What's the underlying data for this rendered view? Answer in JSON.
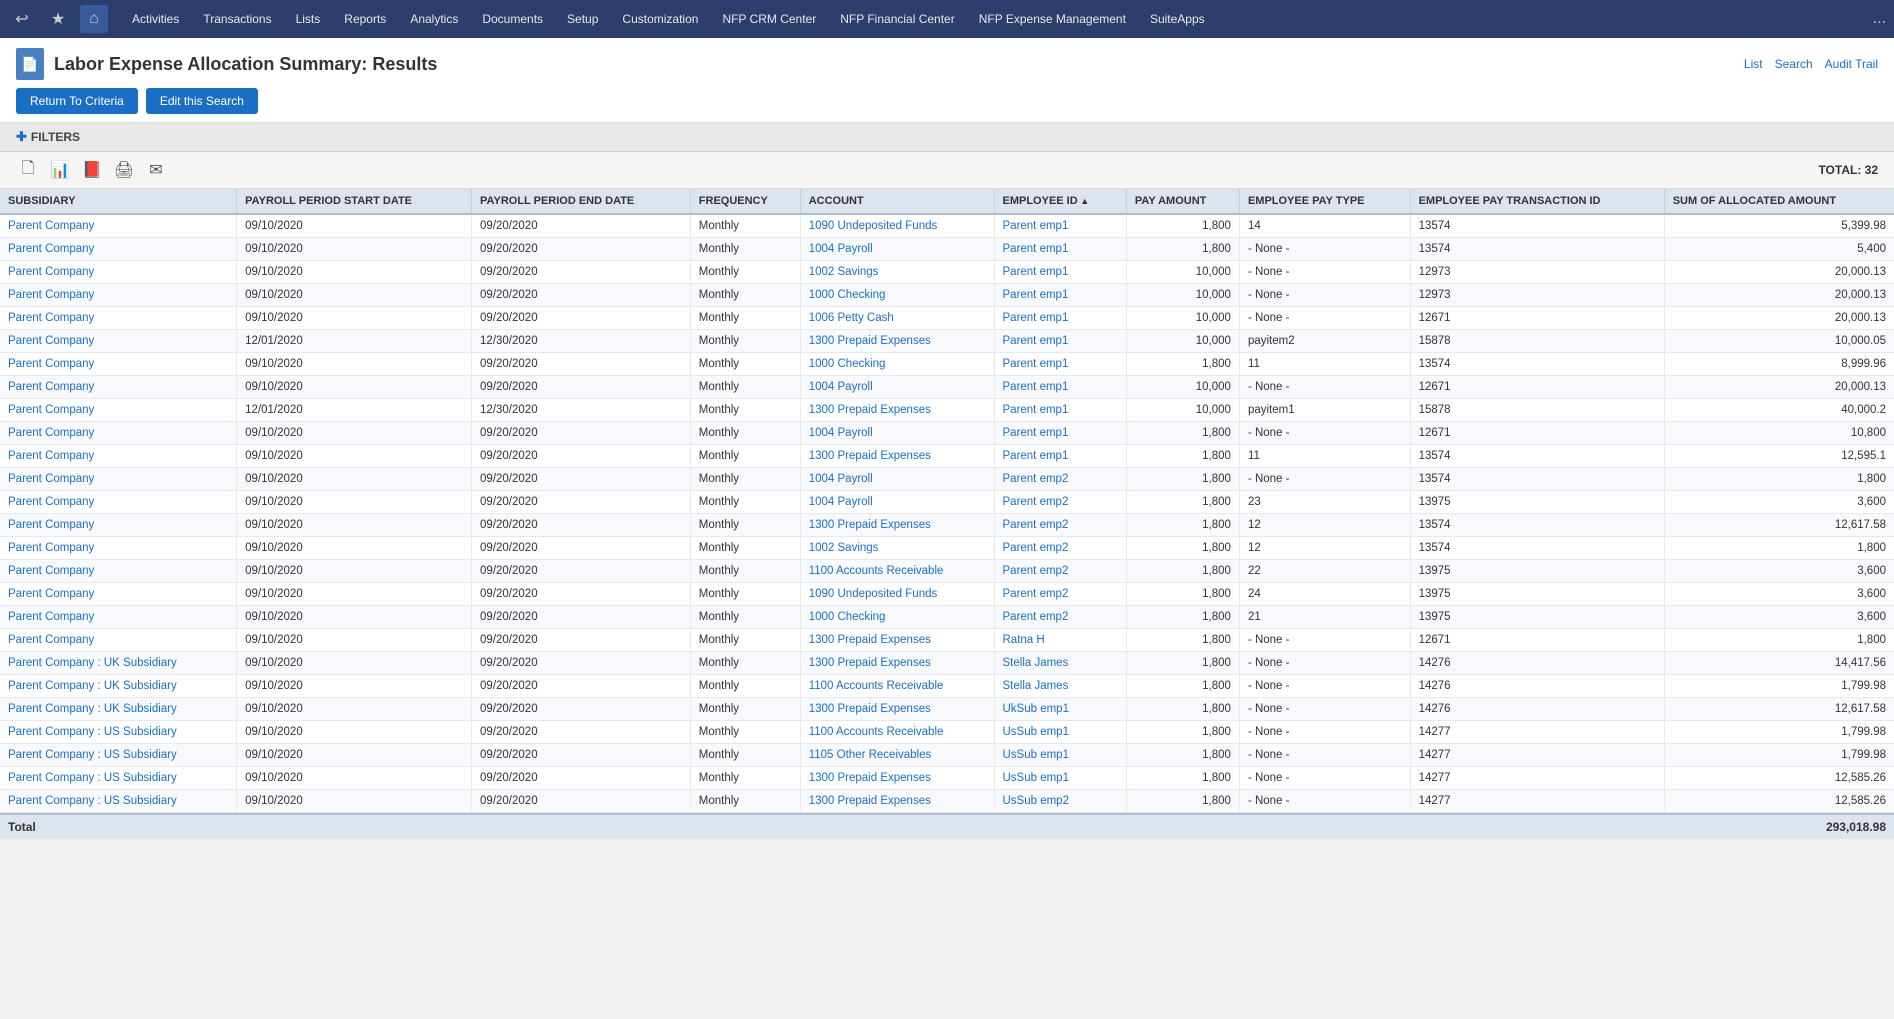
{
  "nav": {
    "items": [
      {
        "label": "Activities"
      },
      {
        "label": "Transactions"
      },
      {
        "label": "Lists"
      },
      {
        "label": "Reports"
      },
      {
        "label": "Analytics"
      },
      {
        "label": "Documents"
      },
      {
        "label": "Setup"
      },
      {
        "label": "Customization"
      },
      {
        "label": "NFP CRM Center"
      },
      {
        "label": "NFP Financial Center"
      },
      {
        "label": "NFP Expense Management"
      },
      {
        "label": "SuiteApps"
      }
    ],
    "more": "..."
  },
  "page": {
    "title": "Labor Expense Allocation Summary: Results",
    "icon": "📄",
    "actions": [
      "List",
      "Search",
      "Audit Trail"
    ],
    "buttons": [
      {
        "label": "Return To Criteria",
        "key": "return-criteria"
      },
      {
        "label": "Edit this Search",
        "key": "edit-search"
      }
    ],
    "filters_label": "FILTERS",
    "total_label": "TOTAL: 32"
  },
  "toolbar": {
    "icons": [
      {
        "name": "new-icon",
        "symbol": "🗋"
      },
      {
        "name": "excel-icon",
        "symbol": "📊"
      },
      {
        "name": "pdf-icon",
        "symbol": "📕"
      },
      {
        "name": "print-icon",
        "symbol": "🖨"
      },
      {
        "name": "email-icon",
        "symbol": "✉"
      }
    ]
  },
  "table": {
    "columns": [
      {
        "key": "subsidiary",
        "label": "SUBSIDIARY",
        "sort": "none"
      },
      {
        "key": "start_date",
        "label": "PAYROLL PERIOD START DATE",
        "sort": "none"
      },
      {
        "key": "end_date",
        "label": "PAYROLL PERIOD END DATE",
        "sort": "none"
      },
      {
        "key": "frequency",
        "label": "FREQUENCY",
        "sort": "none"
      },
      {
        "key": "account",
        "label": "ACCOUNT",
        "sort": "none"
      },
      {
        "key": "employee_id",
        "label": "EMPLOYEE ID",
        "sort": "asc"
      },
      {
        "key": "pay_amount",
        "label": "PAY AMOUNT",
        "sort": "none"
      },
      {
        "key": "pay_type",
        "label": "EMPLOYEE PAY TYPE",
        "sort": "none"
      },
      {
        "key": "transaction_id",
        "label": "EMPLOYEE PAY TRANSACTION ID",
        "sort": "none"
      },
      {
        "key": "allocated_amount",
        "label": "SUM OF ALLOCATED AMOUNT",
        "sort": "none"
      }
    ],
    "rows": [
      {
        "subsidiary": "Parent Company",
        "start_date": "09/10/2020",
        "end_date": "09/20/2020",
        "frequency": "Monthly",
        "account": "1090 Undeposited Funds",
        "employee_id": "Parent emp1",
        "pay_amount": "1,800",
        "pay_type": "14",
        "transaction_id": "13574",
        "allocated_amount": "5,399.98"
      },
      {
        "subsidiary": "Parent Company",
        "start_date": "09/10/2020",
        "end_date": "09/20/2020",
        "frequency": "Monthly",
        "account": "1004 Payroll",
        "employee_id": "Parent emp1",
        "pay_amount": "1,800",
        "pay_type": "- None -",
        "transaction_id": "13574",
        "allocated_amount": "5,400"
      },
      {
        "subsidiary": "Parent Company",
        "start_date": "09/10/2020",
        "end_date": "09/20/2020",
        "frequency": "Monthly",
        "account": "1002 Savings",
        "employee_id": "Parent emp1",
        "pay_amount": "10,000",
        "pay_type": "- None -",
        "transaction_id": "12973",
        "allocated_amount": "20,000.13"
      },
      {
        "subsidiary": "Parent Company",
        "start_date": "09/10/2020",
        "end_date": "09/20/2020",
        "frequency": "Monthly",
        "account": "1000 Checking",
        "employee_id": "Parent emp1",
        "pay_amount": "10,000",
        "pay_type": "- None -",
        "transaction_id": "12973",
        "allocated_amount": "20,000.13"
      },
      {
        "subsidiary": "Parent Company",
        "start_date": "09/10/2020",
        "end_date": "09/20/2020",
        "frequency": "Monthly",
        "account": "1006 Petty Cash",
        "employee_id": "Parent emp1",
        "pay_amount": "10,000",
        "pay_type": "- None -",
        "transaction_id": "12671",
        "allocated_amount": "20,000.13"
      },
      {
        "subsidiary": "Parent Company",
        "start_date": "12/01/2020",
        "end_date": "12/30/2020",
        "frequency": "Monthly",
        "account": "1300 Prepaid Expenses",
        "employee_id": "Parent emp1",
        "pay_amount": "10,000",
        "pay_type": "payitem2",
        "transaction_id": "15878",
        "allocated_amount": "10,000.05"
      },
      {
        "subsidiary": "Parent Company",
        "start_date": "09/10/2020",
        "end_date": "09/20/2020",
        "frequency": "Monthly",
        "account": "1000 Checking",
        "employee_id": "Parent emp1",
        "pay_amount": "1,800",
        "pay_type": "11",
        "transaction_id": "13574",
        "allocated_amount": "8,999.96"
      },
      {
        "subsidiary": "Parent Company",
        "start_date": "09/10/2020",
        "end_date": "09/20/2020",
        "frequency": "Monthly",
        "account": "1004 Payroll",
        "employee_id": "Parent emp1",
        "pay_amount": "10,000",
        "pay_type": "- None -",
        "transaction_id": "12671",
        "allocated_amount": "20,000.13"
      },
      {
        "subsidiary": "Parent Company",
        "start_date": "12/01/2020",
        "end_date": "12/30/2020",
        "frequency": "Monthly",
        "account": "1300 Prepaid Expenses",
        "employee_id": "Parent emp1",
        "pay_amount": "10,000",
        "pay_type": "payitem1",
        "transaction_id": "15878",
        "allocated_amount": "40,000.2"
      },
      {
        "subsidiary": "Parent Company",
        "start_date": "09/10/2020",
        "end_date": "09/20/2020",
        "frequency": "Monthly",
        "account": "1004 Payroll",
        "employee_id": "Parent emp1",
        "pay_amount": "1,800",
        "pay_type": "- None -",
        "transaction_id": "12671",
        "allocated_amount": "10,800"
      },
      {
        "subsidiary": "Parent Company",
        "start_date": "09/10/2020",
        "end_date": "09/20/2020",
        "frequency": "Monthly",
        "account": "1300 Prepaid Expenses",
        "employee_id": "Parent emp1",
        "pay_amount": "1,800",
        "pay_type": "11",
        "transaction_id": "13574",
        "allocated_amount": "12,595.1"
      },
      {
        "subsidiary": "Parent Company",
        "start_date": "09/10/2020",
        "end_date": "09/20/2020",
        "frequency": "Monthly",
        "account": "1004 Payroll",
        "employee_id": "Parent emp2",
        "pay_amount": "1,800",
        "pay_type": "- None -",
        "transaction_id": "13574",
        "allocated_amount": "1,800"
      },
      {
        "subsidiary": "Parent Company",
        "start_date": "09/10/2020",
        "end_date": "09/20/2020",
        "frequency": "Monthly",
        "account": "1004 Payroll",
        "employee_id": "Parent emp2",
        "pay_amount": "1,800",
        "pay_type": "23",
        "transaction_id": "13975",
        "allocated_amount": "3,600"
      },
      {
        "subsidiary": "Parent Company",
        "start_date": "09/10/2020",
        "end_date": "09/20/2020",
        "frequency": "Monthly",
        "account": "1300 Prepaid Expenses",
        "employee_id": "Parent emp2",
        "pay_amount": "1,800",
        "pay_type": "12",
        "transaction_id": "13574",
        "allocated_amount": "12,617.58"
      },
      {
        "subsidiary": "Parent Company",
        "start_date": "09/10/2020",
        "end_date": "09/20/2020",
        "frequency": "Monthly",
        "account": "1002 Savings",
        "employee_id": "Parent emp2",
        "pay_amount": "1,800",
        "pay_type": "12",
        "transaction_id": "13574",
        "allocated_amount": "1,800"
      },
      {
        "subsidiary": "Parent Company",
        "start_date": "09/10/2020",
        "end_date": "09/20/2020",
        "frequency": "Monthly",
        "account": "1100 Accounts Receivable",
        "employee_id": "Parent emp2",
        "pay_amount": "1,800",
        "pay_type": "22",
        "transaction_id": "13975",
        "allocated_amount": "3,600"
      },
      {
        "subsidiary": "Parent Company",
        "start_date": "09/10/2020",
        "end_date": "09/20/2020",
        "frequency": "Monthly",
        "account": "1090 Undeposited Funds",
        "employee_id": "Parent emp2",
        "pay_amount": "1,800",
        "pay_type": "24",
        "transaction_id": "13975",
        "allocated_amount": "3,600"
      },
      {
        "subsidiary": "Parent Company",
        "start_date": "09/10/2020",
        "end_date": "09/20/2020",
        "frequency": "Monthly",
        "account": "1000 Checking",
        "employee_id": "Parent emp2",
        "pay_amount": "1,800",
        "pay_type": "21",
        "transaction_id": "13975",
        "allocated_amount": "3,600"
      },
      {
        "subsidiary": "Parent Company",
        "start_date": "09/10/2020",
        "end_date": "09/20/2020",
        "frequency": "Monthly",
        "account": "1300 Prepaid Expenses",
        "employee_id": "Ratna H",
        "pay_amount": "1,800",
        "pay_type": "- None -",
        "transaction_id": "12671",
        "allocated_amount": "1,800"
      },
      {
        "subsidiary": "Parent Company : UK Subsidiary",
        "start_date": "09/10/2020",
        "end_date": "09/20/2020",
        "frequency": "Monthly",
        "account": "1300 Prepaid Expenses",
        "employee_id": "Stella James",
        "pay_amount": "1,800",
        "pay_type": "- None -",
        "transaction_id": "14276",
        "allocated_amount": "14,417.56"
      },
      {
        "subsidiary": "Parent Company : UK Subsidiary",
        "start_date": "09/10/2020",
        "end_date": "09/20/2020",
        "frequency": "Monthly",
        "account": "1100 Accounts Receivable",
        "employee_id": "Stella James",
        "pay_amount": "1,800",
        "pay_type": "- None -",
        "transaction_id": "14276",
        "allocated_amount": "1,799.98"
      },
      {
        "subsidiary": "Parent Company : UK Subsidiary",
        "start_date": "09/10/2020",
        "end_date": "09/20/2020",
        "frequency": "Monthly",
        "account": "1300 Prepaid Expenses",
        "employee_id": "UkSub emp1",
        "pay_amount": "1,800",
        "pay_type": "- None -",
        "transaction_id": "14276",
        "allocated_amount": "12,617.58"
      },
      {
        "subsidiary": "Parent Company : US Subsidiary",
        "start_date": "09/10/2020",
        "end_date": "09/20/2020",
        "frequency": "Monthly",
        "account": "1100 Accounts Receivable",
        "employee_id": "UsSub emp1",
        "pay_amount": "1,800",
        "pay_type": "- None -",
        "transaction_id": "14277",
        "allocated_amount": "1,799.98"
      },
      {
        "subsidiary": "Parent Company : US Subsidiary",
        "start_date": "09/10/2020",
        "end_date": "09/20/2020",
        "frequency": "Monthly",
        "account": "1105 Other Receivables",
        "employee_id": "UsSub emp1",
        "pay_amount": "1,800",
        "pay_type": "- None -",
        "transaction_id": "14277",
        "allocated_amount": "1,799.98"
      },
      {
        "subsidiary": "Parent Company : US Subsidiary",
        "start_date": "09/10/2020",
        "end_date": "09/20/2020",
        "frequency": "Monthly",
        "account": "1300 Prepaid Expenses",
        "employee_id": "UsSub emp1",
        "pay_amount": "1,800",
        "pay_type": "- None -",
        "transaction_id": "14277",
        "allocated_amount": "12,585.26"
      },
      {
        "subsidiary": "Parent Company : US Subsidiary",
        "start_date": "09/10/2020",
        "end_date": "09/20/2020",
        "frequency": "Monthly",
        "account": "1300 Prepaid Expenses",
        "employee_id": "UsSub emp2",
        "pay_amount": "1,800",
        "pay_type": "- None -",
        "transaction_id": "14277",
        "allocated_amount": "12,585.26"
      }
    ],
    "footer": {
      "label": "Total",
      "amount": "293,018.98"
    }
  }
}
